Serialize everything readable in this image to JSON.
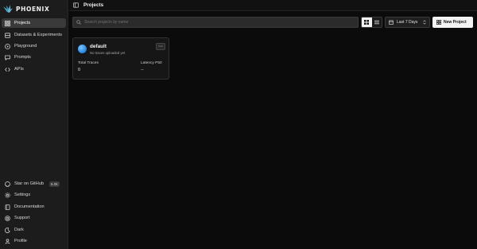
{
  "app": {
    "brand": "PHOENIX"
  },
  "sidebar": {
    "items": [
      {
        "label": "Projects",
        "icon": "grid-icon",
        "active": true
      },
      {
        "label": "Datasets & Experiments",
        "icon": "database-icon"
      },
      {
        "label": "Playground",
        "icon": "play-circle-icon"
      },
      {
        "label": "Prompts",
        "icon": "chat-bubble-icon"
      },
      {
        "label": "APIs",
        "icon": "code-brackets-icon"
      }
    ],
    "footer": [
      {
        "label": "Star on GitHub",
        "icon": "github-icon",
        "badge": "6.0k"
      },
      {
        "label": "Settings",
        "icon": "gear-icon"
      },
      {
        "label": "Documentation",
        "icon": "book-icon"
      },
      {
        "label": "Support",
        "icon": "lifebuoy-icon"
      },
      {
        "label": "Dark",
        "icon": "moon-icon"
      },
      {
        "label": "Profile",
        "icon": "user-icon"
      }
    ]
  },
  "header": {
    "title": "Projects",
    "toggle_icon": "sidebar-toggle-icon"
  },
  "toolbar": {
    "search_placeholder": "Search projects by name",
    "date_range": "Last 7 Days",
    "new_project_label": "New Project",
    "view_mode": "grid"
  },
  "projects": [
    {
      "name": "default",
      "subtitle": "No traces uploaded yet",
      "metrics": [
        {
          "label": "Total Traces",
          "value": "0"
        },
        {
          "label": "Latency P50",
          "value": "--"
        }
      ]
    }
  ],
  "colors": {
    "background": "#0b0b0b",
    "sidebar": "#1c1c1c",
    "accent": "#2a8ee8"
  }
}
